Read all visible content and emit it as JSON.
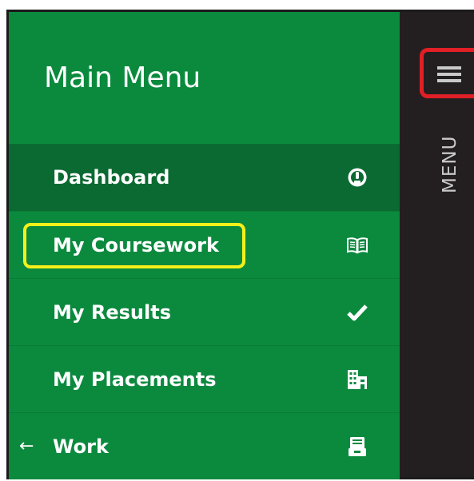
{
  "sidebar": {
    "title": "Main Menu",
    "items": [
      {
        "label": "Dashboard",
        "icon": "dashboard-icon",
        "active": true
      },
      {
        "label": "My Coursework",
        "icon": "open-book-icon",
        "active": false,
        "highlighted": true
      },
      {
        "label": "My Results",
        "icon": "checkmark-icon",
        "active": false
      },
      {
        "label": "My Placements",
        "icon": "building-icon",
        "active": false
      },
      {
        "label": "Work",
        "icon": "inbox-tray-icon",
        "active": false,
        "prefix": "←"
      }
    ]
  },
  "side_panel": {
    "toggle_label": "MENU",
    "toggle_icon": "hamburger-icon"
  },
  "colors": {
    "sidebar_green": "#0b8a3e",
    "active_item_green": "#0a6a31",
    "highlight_yellow": "#f5f01a",
    "highlight_red": "#e11f26",
    "dark_panel": "#231f20"
  }
}
